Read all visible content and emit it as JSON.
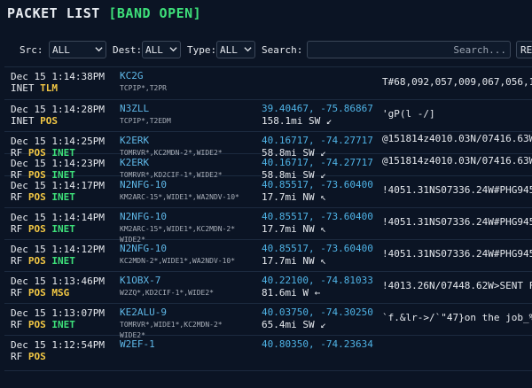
{
  "header": {
    "title": "PACKET LIST",
    "status": "[BAND OPEN]"
  },
  "filters": {
    "src_label": "Src:",
    "src_value": "ALL",
    "dest_label": "Dest:",
    "dest_value": "ALL",
    "type_label": "Type:",
    "type_value": "ALL",
    "search_label": "Search:",
    "search_placeholder": "Search...",
    "reset_label": "RE"
  },
  "packets": [
    {
      "time": "Dec 15 1:14:38PM",
      "source": "INET",
      "types": [
        "TLM"
      ],
      "inet": "",
      "callsign": "KC2G",
      "path": "TCPIP*,T2PR",
      "position": "",
      "distance": "",
      "data": "T#68,092,057,009,067,056,1"
    },
    {
      "time": "Dec 15 1:14:28PM",
      "source": "INET",
      "types": [
        "POS"
      ],
      "inet": "",
      "callsign": "N3ZLL",
      "path": "TCPIP*,T2EDM",
      "position": "39.40467, -75.86867",
      "distance": "158.1mi SW ↙",
      "data": "'gP(l -/]"
    },
    {
      "time": "Dec 15 1:14:25PM",
      "source": "RF",
      "types": [
        "POS"
      ],
      "inet": "INET",
      "callsign": "K2ERK",
      "path": "TOMRVR*,KC2MDN-2*,WIDE2*",
      "position": "40.16717, -74.27717",
      "distance": "58.8mi SW ↙",
      "data": "@151814z4010.03N/07416.63W"
    },
    {
      "time": "Dec 15 1:14:23PM",
      "source": "RF",
      "types": [
        "POS"
      ],
      "inet": "INET",
      "callsign": "K2ERK",
      "path": "TOMRVR*,KD2CIF-1*,WIDE2*",
      "position": "40.16717, -74.27717",
      "distance": "58.8mi SW ↙",
      "data": "@151814z4010.03N/07416.63W"
    },
    {
      "time": "Dec 15 1:14:17PM",
      "source": "RF",
      "types": [
        "POS"
      ],
      "inet": "INET",
      "callsign": "N2NFG-10",
      "path": "KM2ARC-15*,WIDE1*,WA2NDV-10*",
      "position": "40.85517, -73.60400",
      "distance": "17.7mi NW ↖",
      "data": "!4051.31NS07336.24W#PHG945"
    },
    {
      "time": "Dec 15 1:14:14PM",
      "source": "RF",
      "types": [
        "POS"
      ],
      "inet": "INET",
      "callsign": "N2NFG-10",
      "path": "KM2ARC-15*,WIDE1*,KC2MDN-2* WIDE2*",
      "position": "40.85517, -73.60400",
      "distance": "17.7mi NW ↖",
      "data": "!4051.31NS07336.24W#PHG945"
    },
    {
      "time": "Dec 15 1:14:12PM",
      "source": "RF",
      "types": [
        "POS"
      ],
      "inet": "INET",
      "callsign": "N2NFG-10",
      "path": "KC2MDN-2*,WIDE1*,WA2NDV-10*",
      "position": "40.85517, -73.60400",
      "distance": "17.7mi NW ↖",
      "data": "!4051.31NS07336.24W#PHG945"
    },
    {
      "time": "Dec 15 1:13:46PM",
      "source": "RF",
      "types": [
        "POS",
        "MSG"
      ],
      "inet": "",
      "callsign": "K1OBX-7",
      "path": "W2ZQ*,KD2CIF-1*,WIDE2*",
      "position": "40.22100, -74.81033",
      "distance": "81.6mi W ←",
      "data": "!4013.26N/07448.62W>SENT F"
    },
    {
      "time": "Dec 15 1:13:07PM",
      "source": "RF",
      "types": [
        "POS"
      ],
      "inet": "INET",
      "callsign": "KE2ALU-9",
      "path": "TOMRVR*,WIDE1*,KC2MDN-2* WIDE2*",
      "position": "40.03750, -74.30250",
      "distance": "65.4mi SW ↙",
      "data": "`f.&lr->/`\"47}on the job_%"
    },
    {
      "time": "Dec 15 1:12:54PM",
      "source": "RF",
      "types": [
        "POS"
      ],
      "inet": "",
      "callsign": "W2EF-1",
      "path": "",
      "position": "40.80350, -74.23634",
      "distance": "",
      "data": ""
    }
  ],
  "colors": {
    "background": "#0b1424",
    "callsign": "#5fb8e8",
    "position": "#4fb3e6",
    "type": "#f2c744",
    "inet": "#3ee07a"
  }
}
